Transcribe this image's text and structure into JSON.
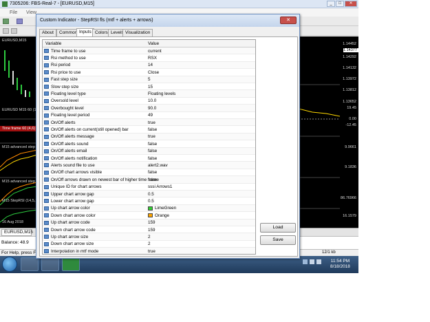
{
  "app": {
    "title": "7305206: FBS-Real-7 - [EURUSD,M15]",
    "menu": [
      "File",
      "View"
    ],
    "chart_tab": "EURUSD,M15",
    "balance_label": "Balance: 48.9",
    "status_help": "For Help, press F1",
    "status_kb": "12/1 kb",
    "clock_time": "11:54 PM",
    "clock_date": "8/18/2018"
  },
  "chart": {
    "left_labels": [
      "EURUSD,M15",
      "EURUSD M15 60 (1,4)",
      "Time frame 60 (4,6)",
      "M15 advanced step",
      "M15 advanced step",
      "M15 StepRSI (14,5,1)",
      "16 Aug 2018",
      "16 Aug 2018"
    ],
    "right_prices": [
      "1.14452",
      "1.14377",
      "1.14292",
      "1.14132",
      "1.13972",
      "1.13812",
      "1.13652",
      "19.45",
      "0.00",
      "-12.45",
      "9.9661",
      "9.1836",
      "86.76966",
      "16.1579"
    ]
  },
  "dialog": {
    "title": "Custom Indicator - StepRSI fls (mtf + alerts + arrows)",
    "close_label": "✕",
    "tabs": [
      "About",
      "Common",
      "Inputs",
      "Colors",
      "Levels",
      "Visualization"
    ],
    "active_tab": "Inputs",
    "col_variable": "Variable",
    "col_value": "Value",
    "load_label": "Load",
    "save_label": "Save",
    "rows": [
      {
        "name": "Time frame to use",
        "value": "current"
      },
      {
        "name": "Rsi method to use",
        "value": "RSX"
      },
      {
        "name": "Rsi period",
        "value": "14"
      },
      {
        "name": "Rsi price to use",
        "value": "Close"
      },
      {
        "name": "Fast step size",
        "value": "5"
      },
      {
        "name": "Slow step size",
        "value": "15"
      },
      {
        "name": "Floating level type",
        "value": "Floating levels"
      },
      {
        "name": "Oversold level",
        "value": "10.0"
      },
      {
        "name": "Overbought level",
        "value": "90.0"
      },
      {
        "name": "Floating level period",
        "value": "49"
      },
      {
        "name": "On/Off alerts",
        "value": "true"
      },
      {
        "name": "On/Off alerts on current(still opened) bar",
        "value": "false"
      },
      {
        "name": "On/Off alerts message",
        "value": "true"
      },
      {
        "name": "On/Off alerts sound",
        "value": "false"
      },
      {
        "name": "On/Off alerts email",
        "value": "false"
      },
      {
        "name": "On/Off alerts notification",
        "value": "false"
      },
      {
        "name": "Alerts sound file to use",
        "value": "alert2.wav"
      },
      {
        "name": "On/Off chart arrows visible",
        "value": "false"
      },
      {
        "name": "On/Off arrows drawn on newest bar of higher time frame",
        "value": "false"
      },
      {
        "name": "Unique ID for chart arrows",
        "value": "sssi Arrows1"
      },
      {
        "name": "Upper chart arrow gap",
        "value": "0.5"
      },
      {
        "name": "Lower chart arrow gap",
        "value": "0.5"
      },
      {
        "name": "Up chart arrow color",
        "value": "LimeGreen",
        "swatch": "#32cd32"
      },
      {
        "name": "Down chart arrow color",
        "value": "Orange",
        "swatch": "#ffa500"
      },
      {
        "name": "Up chart arrow code",
        "value": "159"
      },
      {
        "name": "Down chart arrow code",
        "value": "159"
      },
      {
        "name": "Up chart arrow size",
        "value": "2"
      },
      {
        "name": "Down chart arrow size",
        "value": "2"
      },
      {
        "name": "Interpolation in mtf mode",
        "value": "true"
      }
    ]
  }
}
